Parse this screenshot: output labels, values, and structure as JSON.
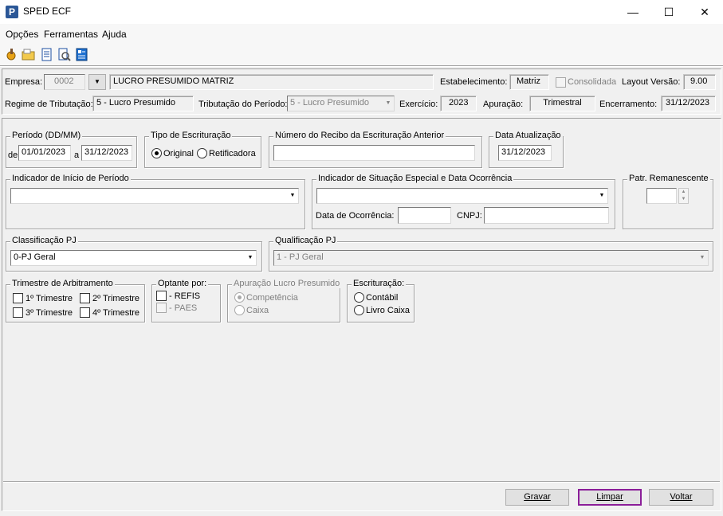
{
  "window": {
    "title": "SPED ECF",
    "app_icon_letter": "P",
    "minimize": "—",
    "maximize": "☐",
    "close": "✕"
  },
  "menu": {
    "items": [
      "Opções",
      "Ferramentas",
      "Ajuda"
    ]
  },
  "toolbar": {
    "icons": [
      "tools-icon",
      "open-folder-icon",
      "document-icon",
      "search-document-icon",
      "report-icon"
    ]
  },
  "header": {
    "empresa_label": "Empresa:",
    "empresa_code": "0002",
    "empresa_name": "LUCRO PRESUMIDO MATRIZ",
    "estabelecimento_label": "Estabelecimento:",
    "estabelecimento_value": "Matriz",
    "consolidada_label": "Consolidada",
    "layout_label": "Layout Versão:",
    "layout_value": "9.00",
    "regime_label": "Regime de Tributação:",
    "regime_value": "5 - Lucro Presumido",
    "tributacao_label": "Tributação do Período:",
    "tributacao_value": "5 - Lucro Presumido",
    "exercicio_label": "Exercício:",
    "exercicio_value": "2023",
    "apuracao_label": "Apuração:",
    "apuracao_value": "Trimestral",
    "encerramento_label": "Encerramento:",
    "encerramento_value": "31/12/2023"
  },
  "form": {
    "periodo": {
      "title": "Período (DD/MM)",
      "de_label": "de",
      "de_value": "01/01/2023",
      "a_label": "a",
      "a_value": "31/12/2023"
    },
    "tipo": {
      "title": "Tipo de Escrituração",
      "original": "Original",
      "retificadora": "Retificadora",
      "selected": "original"
    },
    "recibo": {
      "title": "Número do Recibo da Escrituração Anterior",
      "value": ""
    },
    "data_atualizacao": {
      "title": "Data Atualização",
      "value": "31/12/2023"
    },
    "indicador_inicio": {
      "title": "Indicador de Início de Período",
      "value": ""
    },
    "situacao_especial": {
      "title": "Indicador de Situação Especial e Data Ocorrência",
      "value": "",
      "data_label": "Data de Ocorrência:",
      "data_value": "",
      "cnpj_label": "CNPJ:",
      "cnpj_value": ""
    },
    "patr_remanescente": {
      "title": "Patr. Remanescente",
      "value": ""
    },
    "classificacao": {
      "title": "Classificação PJ",
      "value": "0-PJ Geral"
    },
    "qualificacao": {
      "title": "Qualificação PJ",
      "value": "1 - PJ Geral"
    },
    "trimestre": {
      "title": "Trimestre de Arbitramento",
      "t1": "1º Trimestre",
      "t2": "2º Trimestre",
      "t3": "3º Trimestre",
      "t4": "4º Trimestre"
    },
    "optante": {
      "title": "Optante por:",
      "refis": "- REFIS",
      "paes": "- PAES"
    },
    "apuracao_lp": {
      "title": "Apuração Lucro Presumido",
      "competencia": "Competência",
      "caixa": "Caixa"
    },
    "escrituracao": {
      "title": "Escrituração:",
      "contabil": "Contábil",
      "livro_caixa": "Livro Caixa"
    }
  },
  "buttons": {
    "gravar": "Gravar",
    "limpar": "Limpar",
    "voltar": "Voltar"
  },
  "colors": {
    "focus_border": "#8b1e99",
    "window_bg": "#f0f0f0"
  }
}
